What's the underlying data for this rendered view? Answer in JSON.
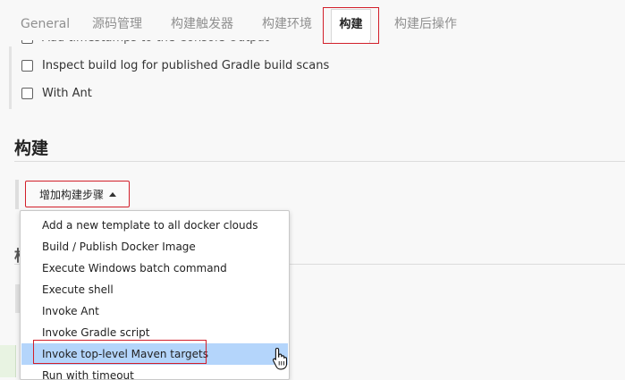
{
  "tabs": [
    {
      "label": "General"
    },
    {
      "label": "源码管理"
    },
    {
      "label": "构建触发器"
    },
    {
      "label": "构建环境"
    },
    {
      "label": "构建",
      "active": true
    },
    {
      "label": "构建后操作"
    }
  ],
  "options": {
    "timestamps_label": "Add timestamps to the Console Output",
    "gradle_scans_label": "Inspect build log for published Gradle build scans",
    "with_ant_label": "With Ant"
  },
  "build_section": {
    "title": "构建",
    "add_step_label": "增加构建步骤"
  },
  "post_build_section": {
    "title_fragment": "构"
  },
  "menu": {
    "items": [
      {
        "label": "Add a new template to all docker clouds"
      },
      {
        "label": "Build / Publish Docker Image"
      },
      {
        "label": "Execute Windows batch command"
      },
      {
        "label": "Execute shell"
      },
      {
        "label": "Invoke Ant"
      },
      {
        "label": "Invoke Gradle script"
      },
      {
        "label": "Invoke top-level Maven targets",
        "hovered": true
      },
      {
        "label": "Run with timeout"
      }
    ]
  },
  "colors": {
    "highlight_red": "#d21f2a",
    "menu_hover": "#b4d5fb"
  }
}
